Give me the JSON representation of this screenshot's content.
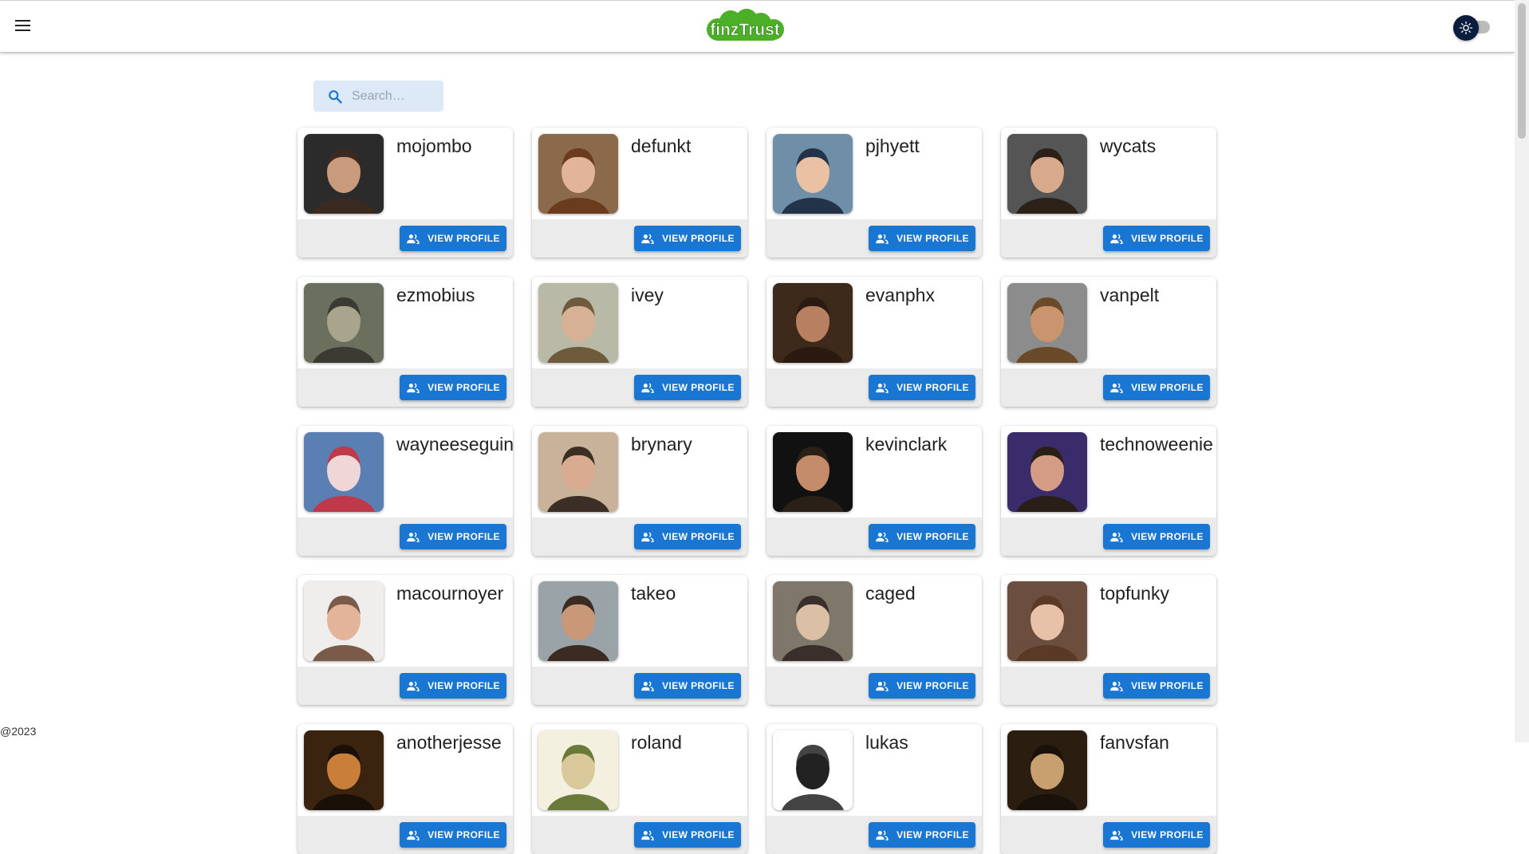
{
  "search": {
    "placeholder": "Search…"
  },
  "footer": {
    "text": "@2023"
  },
  "colors": {
    "primary": "#1976d2",
    "logo_green": "#4caf28",
    "toggle_thumb": "#0a1d3d"
  },
  "users": [
    {
      "username": "mojombo",
      "button": "VIEW PROFILE"
    },
    {
      "username": "defunkt",
      "button": "VIEW PROFILE"
    },
    {
      "username": "pjhyett",
      "button": "VIEW PROFILE"
    },
    {
      "username": "wycats",
      "button": "VIEW PROFILE"
    },
    {
      "username": "ezmobius",
      "button": "VIEW PROFILE"
    },
    {
      "username": "ivey",
      "button": "VIEW PROFILE"
    },
    {
      "username": "evanphx",
      "button": "VIEW PROFILE"
    },
    {
      "username": "vanpelt",
      "button": "VIEW PROFILE"
    },
    {
      "username": "wayneeseguin",
      "button": "VIEW PROFILE"
    },
    {
      "username": "brynary",
      "button": "VIEW PROFILE"
    },
    {
      "username": "kevinclark",
      "button": "VIEW PROFILE"
    },
    {
      "username": "technoweenie",
      "button": "VIEW PROFILE"
    },
    {
      "username": "macournoyer",
      "button": "VIEW PROFILE"
    },
    {
      "username": "takeo",
      "button": "VIEW PROFILE"
    },
    {
      "username": "caged",
      "button": "VIEW PROFILE"
    },
    {
      "username": "topfunky",
      "button": "VIEW PROFILE"
    },
    {
      "username": "anotherjesse",
      "button": "VIEW PROFILE"
    },
    {
      "username": "roland",
      "button": "VIEW PROFILE"
    },
    {
      "username": "lukas",
      "button": "VIEW PROFILE"
    },
    {
      "username": "fanvsfan",
      "button": "VIEW PROFILE"
    }
  ],
  "avatar_palettes": [
    [
      "#2b2b2b",
      "#c99a7c",
      "#3a2a20"
    ],
    [
      "#8a6a4a",
      "#e2b59a",
      "#6b3b1e"
    ],
    [
      "#6f8fa8",
      "#eac2a3",
      "#23344a"
    ],
    [
      "#555555",
      "#d9a98c",
      "#2b2119"
    ],
    [
      "#6b705e",
      "#a9a48c",
      "#3b3b33"
    ],
    [
      "#b9b9a8",
      "#d6b195",
      "#6e5a3c"
    ],
    [
      "#3e2a1a",
      "#b88060",
      "#2a1a10"
    ],
    [
      "#8c8c8c",
      "#c9946e",
      "#6b4a2a"
    ],
    [
      "#5a7fb3",
      "#efd7d7",
      "#c0394a"
    ],
    [
      "#c8b29a",
      "#d9ab90",
      "#3b2e24"
    ],
    [
      "#111111",
      "#c48c6a",
      "#2a2018"
    ],
    [
      "#3a2c6a",
      "#d49c84",
      "#2a1e18"
    ],
    [
      "#efeeec",
      "#e3b49a",
      "#7a5a48"
    ],
    [
      "#9aa3a8",
      "#c89878",
      "#3b2b22"
    ],
    [
      "#7e776a",
      "#dbc0a6",
      "#3a2f2a"
    ],
    [
      "#6b4e3e",
      "#e8c2a8",
      "#5a3a26"
    ],
    [
      "#3a2410",
      "#c97f3a",
      "#1a1008"
    ],
    [
      "#f4f0e0",
      "#d8c89a",
      "#6a7a3a"
    ],
    [
      "#ffffff",
      "#222222",
      "#444444"
    ],
    [
      "#2b1e10",
      "#c8a070",
      "#1a120a"
    ]
  ]
}
